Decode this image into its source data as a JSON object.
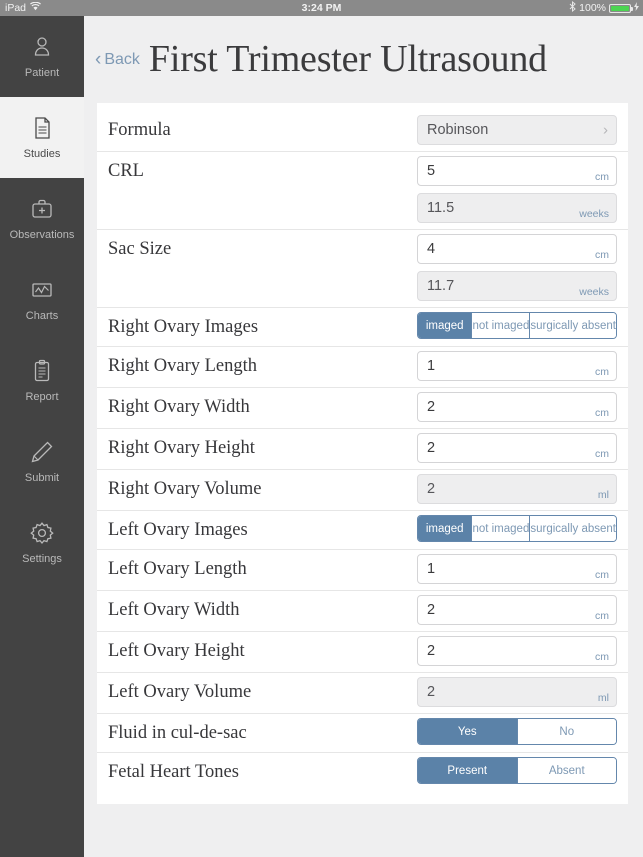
{
  "statusbar": {
    "device": "iPad",
    "wifi_icon": "wifi-icon",
    "time": "3:24 PM",
    "bluetooth_icon": "bluetooth-icon",
    "battery_percent": "100%",
    "battery_level": 100,
    "charging_icon": "lightning-bolt-icon"
  },
  "sidebar": {
    "items": [
      {
        "label": "Patient",
        "icon": "person-icon",
        "active": false
      },
      {
        "label": "Studies",
        "icon": "document-icon",
        "active": true
      },
      {
        "label": "Observations",
        "icon": "medical-bag-icon",
        "active": false
      },
      {
        "label": "Charts",
        "icon": "chart-icon",
        "active": false
      },
      {
        "label": "Report",
        "icon": "clipboard-icon",
        "active": false
      },
      {
        "label": "Submit",
        "icon": "pencil-icon",
        "active": false
      },
      {
        "label": "Settings",
        "icon": "gear-icon",
        "active": false
      }
    ]
  },
  "header": {
    "back_label": "Back",
    "back_chevron": "‹",
    "title": "First Trimester Ultrasound"
  },
  "colors": {
    "accent_blue": "#5b82a8",
    "link_blue": "#7e99b4",
    "sidebar_bg": "#434343",
    "page_bg": "#efeff0",
    "battery_green": "#4cd452"
  },
  "form": {
    "rows": [
      {
        "label": "Formula",
        "type": "select",
        "value": "Robinson",
        "chevron": "›"
      },
      {
        "label": "CRL",
        "type": "fields",
        "fields": [
          {
            "value": "5",
            "unit": "cm",
            "readonly": false
          },
          {
            "value": "11.5",
            "unit": "weeks",
            "readonly": true
          }
        ]
      },
      {
        "label": "Sac Size",
        "type": "fields",
        "fields": [
          {
            "value": "4",
            "unit": "cm",
            "readonly": false
          },
          {
            "value": "11.7",
            "unit": "weeks",
            "readonly": true
          }
        ]
      },
      {
        "label": "Right Ovary Images",
        "type": "segmented",
        "options": [
          "imaged",
          "not imaged",
          "surgically absent"
        ],
        "selected": "imaged"
      },
      {
        "label": "Right Ovary Length",
        "type": "fields",
        "fields": [
          {
            "value": "1",
            "unit": "cm",
            "readonly": false
          }
        ]
      },
      {
        "label": "Right Ovary Width",
        "type": "fields",
        "fields": [
          {
            "value": "2",
            "unit": "cm",
            "readonly": false
          }
        ]
      },
      {
        "label": "Right Ovary Height",
        "type": "fields",
        "fields": [
          {
            "value": "2",
            "unit": "cm",
            "readonly": false
          }
        ]
      },
      {
        "label": "Right Ovary Volume",
        "type": "fields",
        "fields": [
          {
            "value": "2",
            "unit": "ml",
            "readonly": true
          }
        ]
      },
      {
        "label": "Left Ovary Images",
        "type": "segmented",
        "options": [
          "imaged",
          "not imaged",
          "surgically absent"
        ],
        "selected": "imaged"
      },
      {
        "label": "Left Ovary Length",
        "type": "fields",
        "fields": [
          {
            "value": "1",
            "unit": "cm",
            "readonly": false
          }
        ]
      },
      {
        "label": "Left Ovary Width",
        "type": "fields",
        "fields": [
          {
            "value": "2",
            "unit": "cm",
            "readonly": false
          }
        ]
      },
      {
        "label": "Left Ovary Height",
        "type": "fields",
        "fields": [
          {
            "value": "2",
            "unit": "cm",
            "readonly": false
          }
        ]
      },
      {
        "label": "Left Ovary Volume",
        "type": "fields",
        "fields": [
          {
            "value": "2",
            "unit": "ml",
            "readonly": true
          }
        ]
      },
      {
        "label": "Fluid in cul-de-sac",
        "type": "segmented",
        "options": [
          "Yes",
          "No"
        ],
        "selected": "Yes"
      },
      {
        "label": "Fetal Heart Tones",
        "type": "segmented",
        "options": [
          "Present",
          "Absent"
        ],
        "selected": "Present"
      }
    ]
  }
}
